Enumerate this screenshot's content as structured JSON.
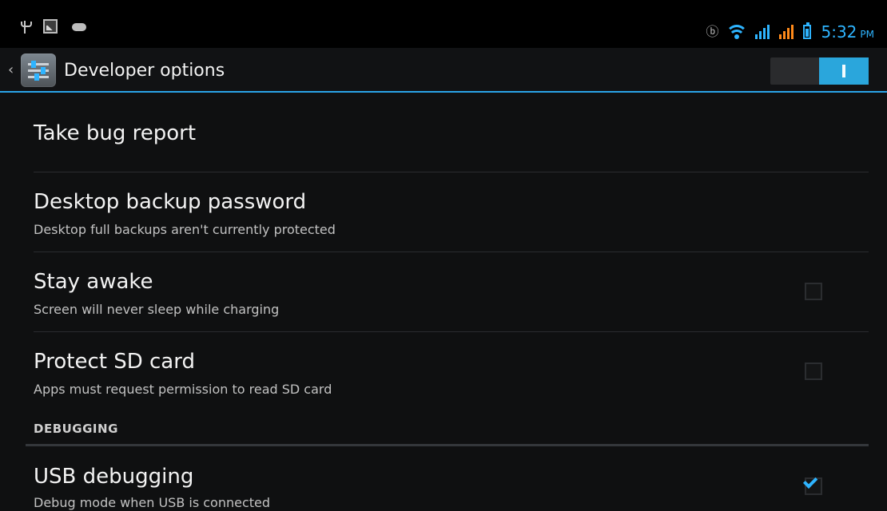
{
  "status_bar": {
    "left_icons": [
      "usb-icon",
      "image-notification-icon",
      "gamepad-icon"
    ],
    "right_icons": [
      "bluetooth-icon",
      "wifi-icon",
      "signal-icon",
      "signal-icon",
      "battery-icon"
    ],
    "time": "5:32",
    "ampm": "PM",
    "accent_color": "#2eb4ff"
  },
  "action_bar": {
    "title": "Developer options",
    "back_icon": "chevron-left-icon",
    "app_icon": "settings-sliders-icon",
    "toggle_state": "on"
  },
  "preferences": [
    {
      "title": "Take bug report",
      "summary": ""
    },
    {
      "title": "Desktop backup password",
      "summary": "Desktop full backups aren't currently protected"
    },
    {
      "title": "Stay awake",
      "summary": "Screen will never sleep while charging",
      "checked": false
    },
    {
      "title": "Protect SD card",
      "summary": "Apps must request permission to read SD card",
      "checked": false
    }
  ],
  "debugging_section": {
    "header": "DEBUGGING",
    "items": [
      {
        "title": "USB debugging",
        "summary": "Debug mode when USB is connected",
        "checked": true
      }
    ]
  }
}
